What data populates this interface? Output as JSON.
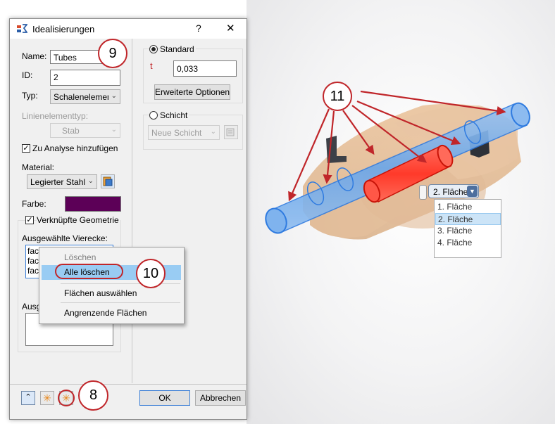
{
  "dialog": {
    "title": "Idealisierungen",
    "help_label": "?",
    "close_label": "✕",
    "name_label": "Name:",
    "name_value": "Tubes",
    "id_label": "ID:",
    "id_value": "2",
    "typ_label": "Typ:",
    "typ_value": "Schalenelemente",
    "linien_label": "Linienelementtyp:",
    "linien_value": "Stab",
    "analyse_label": "Zu Analyse hinzufügen",
    "material_label": "Material:",
    "material_value": "Legierter Stahl",
    "farbe_label": "Farbe:",
    "farbe_color": "#5c0057",
    "verknuepft_label": "Verknüpfte Geometrie",
    "ausgewaehlt_label": "Ausgewählte Vierecke:",
    "face_items": [
      "face",
      "face",
      "face"
    ],
    "ausg2_label": "Ausg",
    "standard_label": "Standard",
    "t_label": "t",
    "t_value": "0,033",
    "erweitert_label": "Erweiterte Optionen",
    "schicht_label": "Schicht",
    "neue_schicht_value": "Neue Schicht",
    "ok_label": "OK",
    "cancel_label": "Abbrechen"
  },
  "context_menu": {
    "items": [
      "Löschen",
      "Alle löschen",
      "Flächen auswählen",
      "Angrenzende Flächen"
    ]
  },
  "callouts": {
    "c8": "8",
    "c9": "9",
    "c10": "10",
    "c11": "11"
  },
  "viewport": {
    "face_select_value": "2. Fläche",
    "face_options": [
      "1. Fläche",
      "2. Fläche",
      "3. Fläche",
      "4. Fläche"
    ]
  },
  "colors": {
    "accent_red": "#c0262a",
    "highlight": "#99ccf3",
    "tube_blue": "#3f8ee6",
    "tube_red": "#e8251b"
  }
}
